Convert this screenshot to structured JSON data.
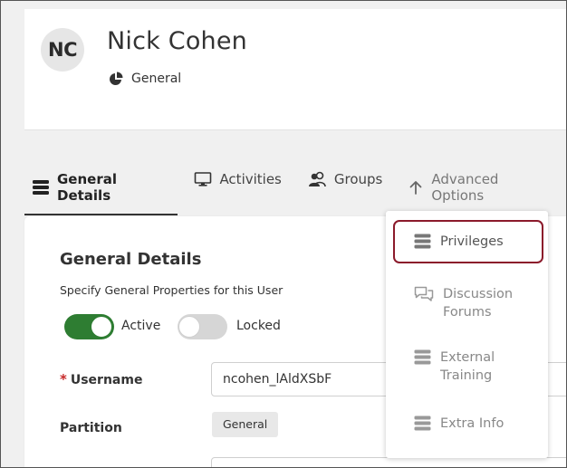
{
  "user": {
    "initials": "NC",
    "name": "Nick Cohen",
    "role": "General"
  },
  "tabs": [
    {
      "label": "General Details",
      "icon": "list-icon",
      "active": true
    },
    {
      "label": "Activities",
      "icon": "monitor-icon",
      "active": false
    },
    {
      "label": "Groups",
      "icon": "users-icon",
      "active": false
    },
    {
      "label": "Advanced Options",
      "icon": "arrow-up-icon",
      "active": false
    }
  ],
  "general": {
    "title": "General Details",
    "subtitle": "Specify General Properties for this User",
    "active_label": "Active",
    "locked_label": "Locked",
    "active_on": true,
    "locked_on": false,
    "username_required_mark": "*",
    "username_label": "Username",
    "username_value": "ncohen_lAldXSbF",
    "partition_label": "Partition",
    "partition_value": "General"
  },
  "advanced_menu": {
    "items": [
      {
        "label": "Privileges",
        "icon": "list-icon",
        "highlighted": true
      },
      {
        "label": "Discussion Forums",
        "line1": "Discussion",
        "line2": "Forums",
        "icon": "chat-icon"
      },
      {
        "label": "External Training",
        "line1": "External",
        "line2": "Training",
        "icon": "list-icon"
      },
      {
        "label": "Extra Info",
        "icon": "list-icon"
      }
    ]
  },
  "colors": {
    "toggle_on": "#2e7d32",
    "toggle_off": "#d6d6d6",
    "highlight_border": "#8b1a2b",
    "required": "#c62828"
  }
}
